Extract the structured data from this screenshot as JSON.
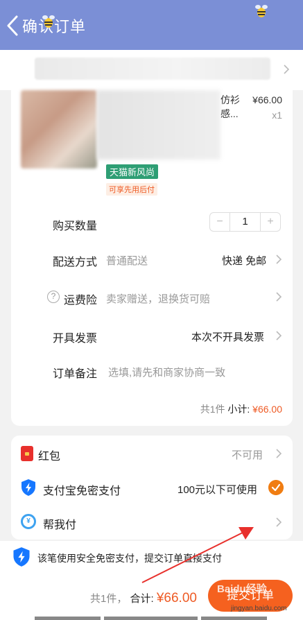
{
  "header": {
    "title": "确认订单"
  },
  "product": {
    "title_fragment": "仿衫\n感...",
    "price": "¥66.00",
    "qty_mark": "x1",
    "tag_tmall": "天猫新风尚",
    "tag_payafter": "可享先用后付"
  },
  "rows": {
    "quantity": {
      "label": "购买数量",
      "value": "1",
      "minus": "−",
      "plus": "+"
    },
    "delivery": {
      "label": "配送方式",
      "sub": "普通配送",
      "value": "快递 免邮"
    },
    "insurance": {
      "label": "运费险",
      "sub": "卖家赠送，退换货可赔",
      "q": "?"
    },
    "invoice": {
      "label": "开具发票",
      "value": "本次不开具发票"
    },
    "remark": {
      "label": "订单备注",
      "placeholder": "选填,请先和商家协商一致"
    }
  },
  "subtotal": {
    "count": "共1件",
    "label": "小计:",
    "value": "¥66.00"
  },
  "payment": {
    "redpacket": {
      "label": "红包",
      "value": "不可用"
    },
    "alipay": {
      "label": "支付宝免密支付",
      "value": "100元以下可使用"
    },
    "helppay": {
      "label": "帮我付",
      "icon_text": "¥"
    }
  },
  "bottom": {
    "notice": "该笔使用安全免密支付，提交订单直接支付",
    "count": "共1件，",
    "total_label": "合计:",
    "total_value": "¥66.00",
    "submit": "提交订单"
  },
  "watermark": {
    "main": "Baidu经验",
    "sub": "jingyan.baidu.com"
  },
  "colors": {
    "header": "#7b8fd6",
    "accent": "#ee5a24",
    "submit": "#f5611f",
    "tag_green": "#2e9e74",
    "alipay_blue": "#1677ff"
  }
}
